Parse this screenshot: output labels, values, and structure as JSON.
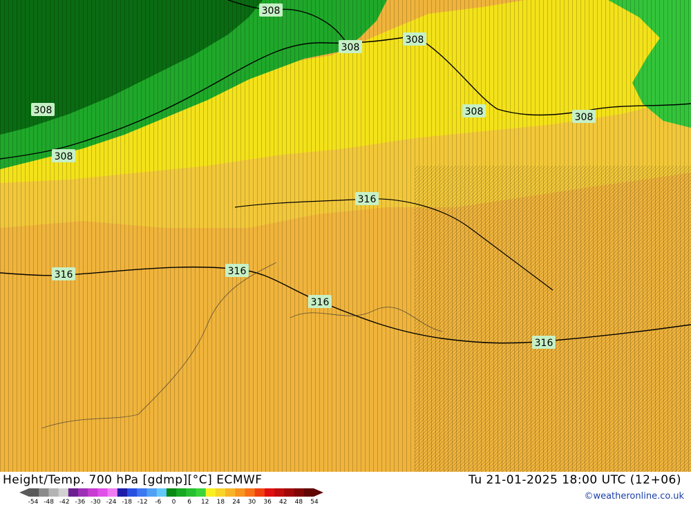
{
  "map": {
    "contour_labels": [
      {
        "text": "308"
      },
      {
        "text": "308"
      },
      {
        "text": "308"
      },
      {
        "text": "308"
      },
      {
        "text": "308"
      },
      {
        "text": "308"
      },
      {
        "text": "308"
      },
      {
        "text": "316"
      },
      {
        "text": "316"
      },
      {
        "text": "316"
      },
      {
        "text": "316"
      },
      {
        "text": "316"
      }
    ],
    "colors": {
      "cold_dark": "#0a6b12",
      "cold": "#1fa82a",
      "green_light": "#33c43a",
      "yellow": "#f4e21a",
      "yellow_orange": "#f2c83a",
      "orange": "#f0b43c",
      "label_bg": "#c6f0c6",
      "contour": "#000000"
    }
  },
  "footer": {
    "title": "Height/Temp. 700 hPa [gdmp][°C] ECMWF",
    "valid_time": "Tu 21-01-2025 18:00 UTC (12+06)",
    "credit": "©weatheronline.co.uk",
    "scale_ticks": [
      "-54",
      "-48",
      "-42",
      "-36",
      "-30",
      "-24",
      "-18",
      "-12",
      "-6",
      "0",
      "6",
      "12",
      "18",
      "24",
      "30",
      "36",
      "42",
      "48",
      "54"
    ],
    "scale_colors": [
      "#5a5a5a",
      "#8c8c8c",
      "#b4b4b4",
      "#d2d2d2",
      "#6c2090",
      "#9c30b4",
      "#c83cd2",
      "#e050e8",
      "#f07cf4",
      "#1c1ca8",
      "#2850e0",
      "#3c78f0",
      "#50a0f4",
      "#64c8f8",
      "#0a8a14",
      "#18a822",
      "#28c030",
      "#3cd43c",
      "#f8f020",
      "#f8d428",
      "#f8b428",
      "#f89420",
      "#f87018",
      "#f04010",
      "#e01010",
      "#c00c0c",
      "#a00808",
      "#800606",
      "#600404"
    ]
  }
}
